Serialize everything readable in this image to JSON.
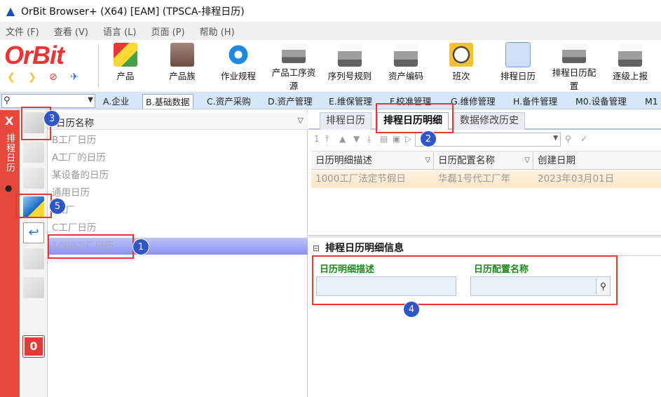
{
  "window": {
    "title": "OrBit Browser+ (X64) [EAM] (TPSCA-排程日历)"
  },
  "menu": [
    "文件 (F)",
    "查看 (V)",
    "语言 (L)",
    "页面 (P)",
    "帮助 (H)"
  ],
  "logo": {
    "text": "OrBit"
  },
  "toolbar": [
    {
      "label": "产品",
      "icon": "product-icon"
    },
    {
      "label": "产品族",
      "icon": "product-family-icon"
    },
    {
      "label": "作业规程",
      "icon": "gear-icon"
    },
    {
      "label": "产品工序资",
      "label2": "源",
      "icon": "printer-icon"
    },
    {
      "label": "序列号规则",
      "icon": "printer-icon"
    },
    {
      "label": "资产编码",
      "icon": "printer-icon"
    },
    {
      "label": "班次",
      "icon": "clock-icon"
    },
    {
      "label": "排程日历",
      "icon": "printer-icon",
      "active": true
    },
    {
      "label": "排程日历配",
      "label2": "置",
      "icon": "printer-icon"
    },
    {
      "label": "逐级上报",
      "icon": "printer-icon"
    }
  ],
  "navtabs": [
    "A.企业",
    "B.基础数据",
    "C.资产采购",
    "D.资产管理",
    "E.维保管理",
    "F.校准管理",
    "G.维修管理",
    "H.备件管理",
    "M0.设备管理",
    "M1"
  ],
  "navtab_selected": "B.基础数据",
  "sidebar": {
    "label": "排程日历"
  },
  "tree": {
    "header": "日历名称",
    "items": [
      "B工厂日历",
      "A工厂的日历",
      "某设备的日历",
      "通用日历",
      "工厂",
      "C工厂日历",
      "1000工厂日历"
    ],
    "selected": "1000工厂日历"
  },
  "subtabs": [
    "排程日历",
    "排程日历明细",
    "数据修改历史"
  ],
  "subtab_selected": "排程日历明细",
  "grid": {
    "page": "1",
    "columns": [
      "日历明细描述",
      "日历配置名称",
      "创建日期"
    ],
    "rows": [
      [
        "1000工厂法定节假日",
        "华磊1号代工厂年",
        "2023年03月01日"
      ]
    ]
  },
  "detail": {
    "title": "排程日历明细信息",
    "fields": [
      {
        "label": "日历明细描述",
        "value": ""
      },
      {
        "label": "日历配置名称",
        "value": ""
      }
    ]
  },
  "badges": [
    "1",
    "2",
    "3",
    "4",
    "5"
  ],
  "colors": {
    "accent_red": "#e53935",
    "badge_blue": "#2f56c9",
    "field_label_green": "#1a8a1a",
    "selection_purple": "#8e90f2"
  }
}
